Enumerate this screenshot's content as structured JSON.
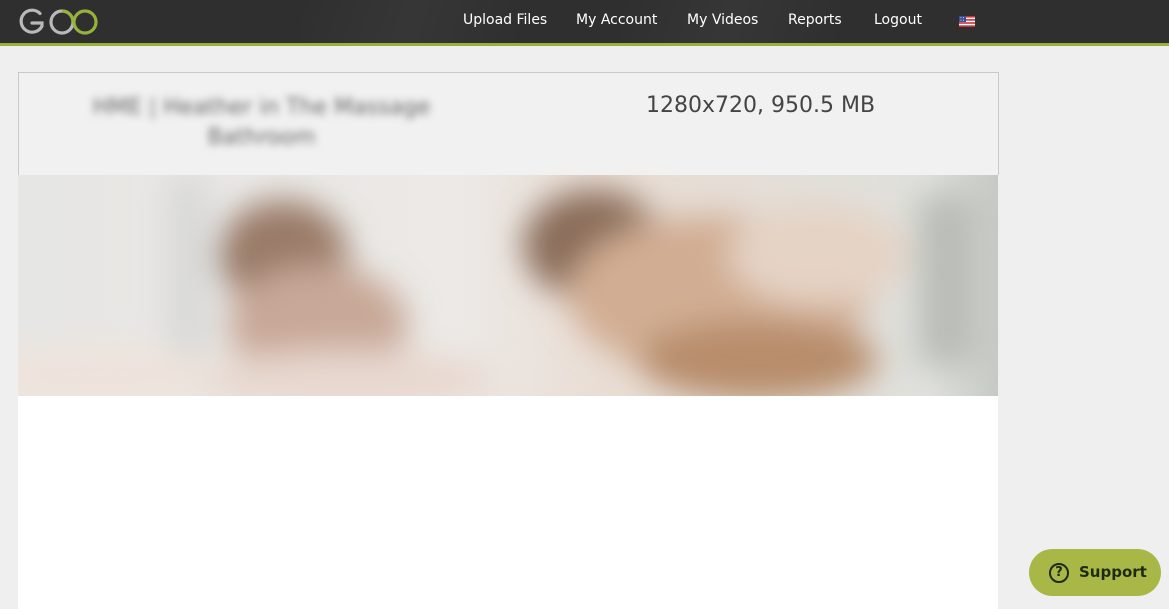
{
  "header": {
    "logo_text": "GOO",
    "nav": [
      {
        "label": "Upload Files"
      },
      {
        "label": "My Account"
      },
      {
        "label": "My Videos"
      },
      {
        "label": "Reports"
      },
      {
        "label": "Logout"
      }
    ],
    "language_flag": "us-flag-icon",
    "accent_color": "#95b23b",
    "bar_color": "#2f2f2f"
  },
  "video": {
    "title": "HME | Heather in The Massage Bathroom",
    "meta": "1280x720, 950.5 MB",
    "thumbnail": "blurred-video-thumbnail"
  },
  "support": {
    "label": "Support",
    "icon": "question-circle-icon",
    "color": "#a8b746"
  }
}
